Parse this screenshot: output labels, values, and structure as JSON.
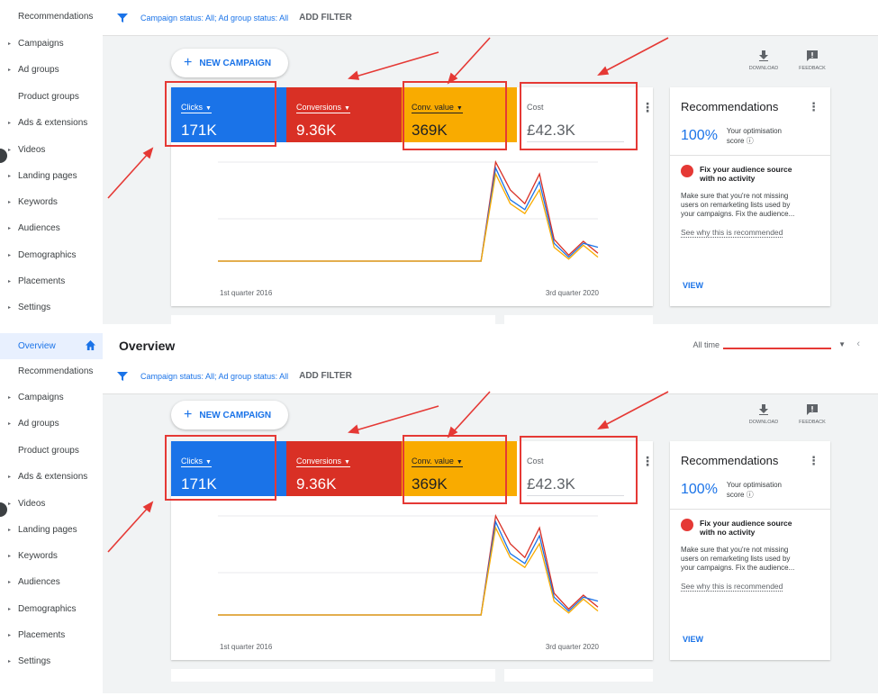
{
  "nav": {
    "overview": "Overview",
    "items": [
      "Recommendations",
      "Campaigns",
      "Ad groups",
      "Product groups",
      "Ads & extensions",
      "Videos",
      "Landing pages",
      "Keywords",
      "Audiences",
      "Demographics",
      "Placements",
      "Settings"
    ],
    "arrows": [
      false,
      true,
      true,
      false,
      true,
      true,
      true,
      true,
      true,
      true,
      true,
      true
    ]
  },
  "header": {
    "title": "Overview",
    "range_label": "All time"
  },
  "filters": {
    "status_text": "Campaign status: All; Ad group status: All",
    "add_filter": "ADD FILTER"
  },
  "actions": {
    "new_campaign": "NEW CAMPAIGN",
    "download": "DOWNLOAD",
    "feedback": "FEEDBACK"
  },
  "metrics": {
    "clicks": {
      "label": "Clicks",
      "value": "171K"
    },
    "conversions": {
      "label": "Conversions",
      "value": "9.36K"
    },
    "conv_value": {
      "label": "Conv. value",
      "value": "369K"
    },
    "cost": {
      "label": "Cost",
      "value": "£42.3K"
    }
  },
  "chart_data": {
    "type": "line",
    "x_start_label": "1st quarter 2016",
    "x_end_label": "3rd quarter 2020",
    "series": [
      {
        "color": "#d93025",
        "values": [
          0,
          0,
          0,
          0,
          0,
          0,
          0,
          0,
          0,
          0,
          0,
          0,
          0,
          0,
          0,
          0,
          0,
          0,
          0,
          100,
          72,
          58,
          88,
          22,
          6,
          20,
          8
        ]
      },
      {
        "color": "#1a73e8",
        "values": [
          0,
          0,
          0,
          0,
          0,
          0,
          0,
          0,
          0,
          0,
          0,
          0,
          0,
          0,
          0,
          0,
          0,
          0,
          0,
          94,
          62,
          52,
          80,
          18,
          4,
          18,
          14
        ]
      },
      {
        "color": "#f9ab00",
        "values": [
          0,
          0,
          0,
          0,
          0,
          0,
          0,
          0,
          0,
          0,
          0,
          0,
          0,
          0,
          0,
          0,
          0,
          0,
          0,
          88,
          58,
          48,
          72,
          14,
          2,
          16,
          4
        ]
      }
    ]
  },
  "recommendations": {
    "title": "Recommendations",
    "score": "100%",
    "score_label_1": "Your optimisation",
    "score_label_2": "score",
    "fix_line_1": "Fix your audience source",
    "fix_line_2": "with no activity",
    "desc_1": "Make sure that you're not missing",
    "desc_2": "users on remarketing lists used by",
    "desc_3": "your campaigns. Fix the audience...",
    "why": "See why this is recommended",
    "view": "VIEW"
  },
  "colors": {
    "accent": "#1a73e8",
    "clicks": "#1a73e8",
    "conversions": "#d93025",
    "conv_value": "#f9ab00",
    "annotation": "#e53935"
  }
}
